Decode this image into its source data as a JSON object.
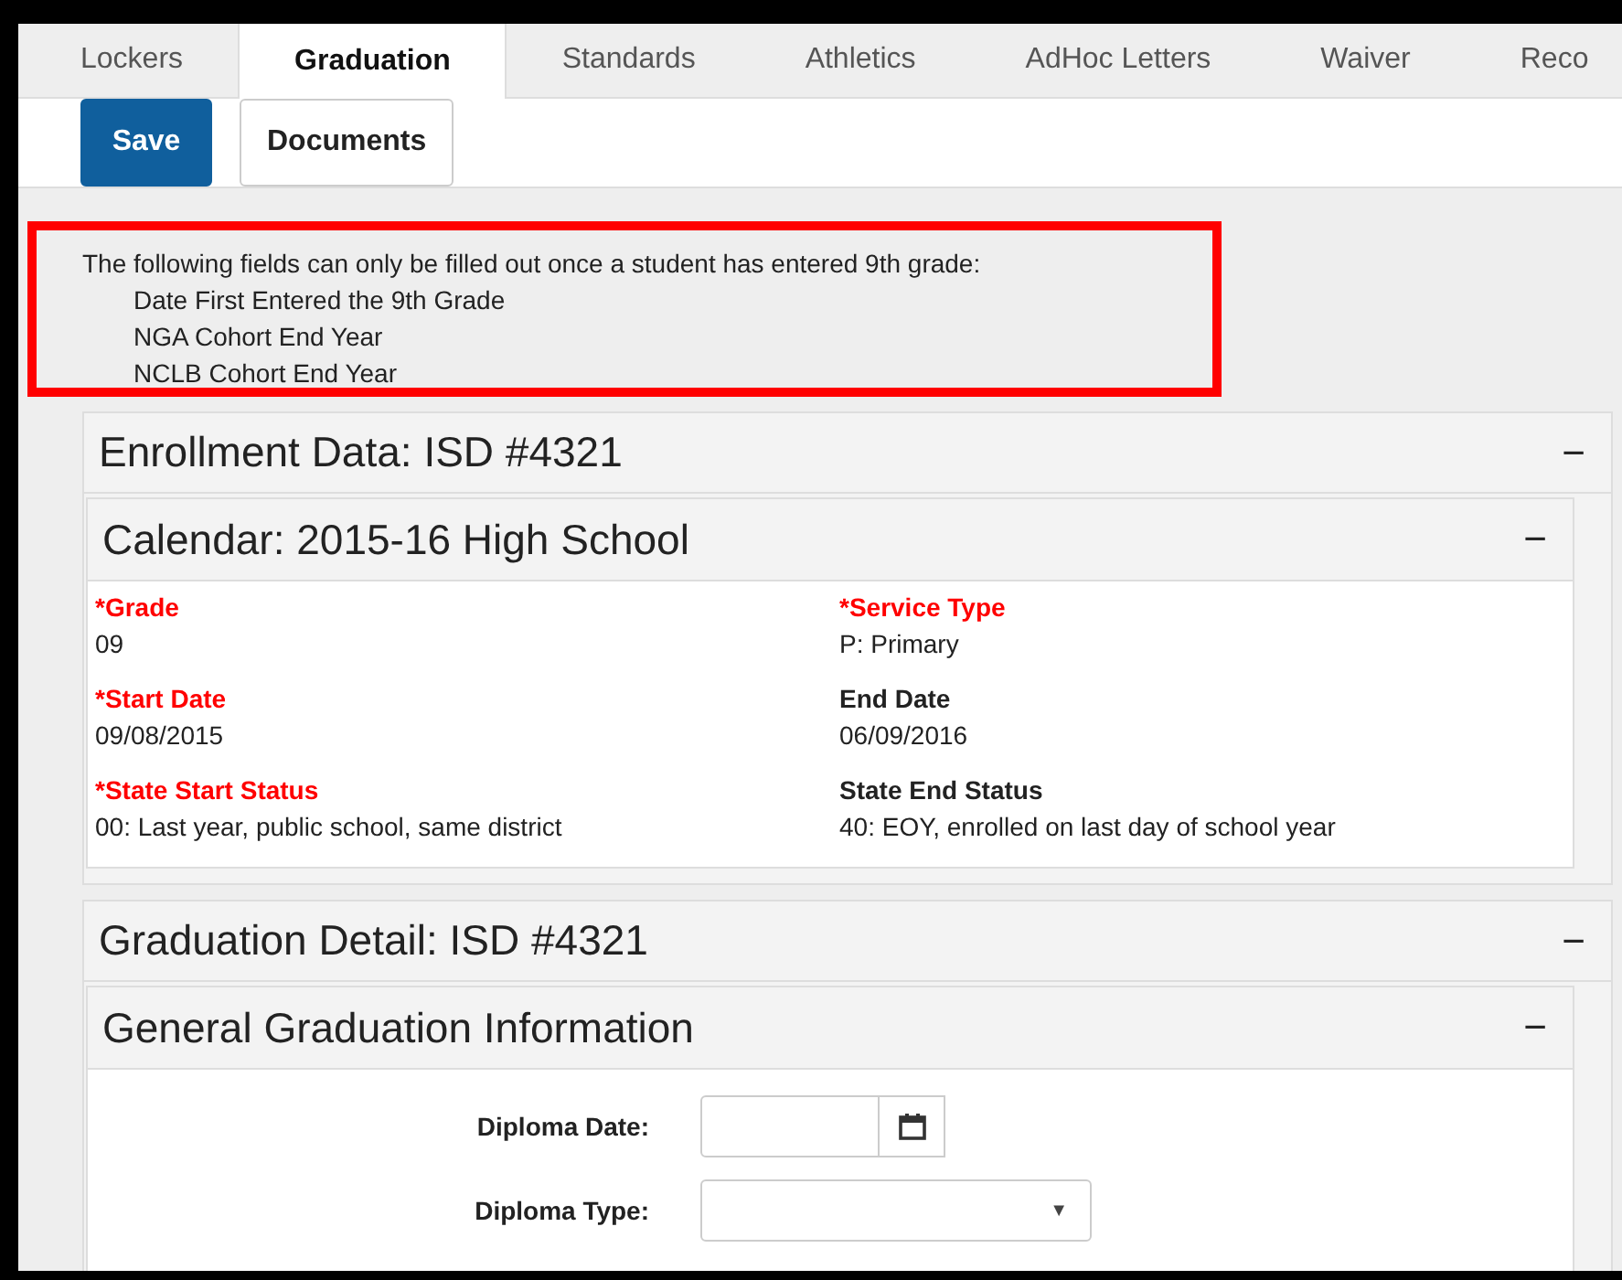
{
  "tabs": [
    {
      "label": "Lockers",
      "selected": false
    },
    {
      "label": "Graduation",
      "selected": true
    },
    {
      "label": "Standards",
      "selected": false
    },
    {
      "label": "Athletics",
      "selected": false
    },
    {
      "label": "AdHoc Letters",
      "selected": false
    },
    {
      "label": "Waiver",
      "selected": false
    },
    {
      "label": "Reco",
      "selected": false
    }
  ],
  "toolbar": [
    {
      "label": "Save",
      "kind": "primary"
    },
    {
      "label": "Documents",
      "kind": "default"
    }
  ],
  "notice": {
    "text": "The following fields can only be filled out once a student has entered 9th grade:",
    "items": [
      "Date First Entered the 9th Grade",
      "NGA Cohort End Year",
      "NCLB Cohort End Year"
    ]
  },
  "enrollment": {
    "title": "Enrollment Data: ISD #4321",
    "toggle": "−",
    "calendar": {
      "title": "Calendar: 2015-16 High School",
      "toggle": "−",
      "fields": [
        {
          "label": "*Grade",
          "required": true,
          "value": "09"
        },
        {
          "label": "*Service Type",
          "required": true,
          "value": "P: Primary"
        },
        {
          "label": "*Start Date",
          "required": true,
          "value": "09/08/2015"
        },
        {
          "label": "End Date",
          "required": false,
          "value": "06/09/2016"
        },
        {
          "label": "*State Start Status",
          "required": true,
          "value": "00: Last year, public school, same district"
        },
        {
          "label": "State End Status",
          "required": false,
          "value": "40: EOY, enrolled on last day of school year"
        }
      ]
    }
  },
  "graduation": {
    "title": "Graduation Detail: ISD #4321",
    "toggle": "−",
    "general": {
      "title": "General Graduation Information",
      "toggle": "−",
      "form": [
        {
          "label": "Diploma Date:",
          "kind": "date"
        },
        {
          "label": "Diploma Type:",
          "kind": "select",
          "caret": "▼"
        }
      ]
    }
  }
}
